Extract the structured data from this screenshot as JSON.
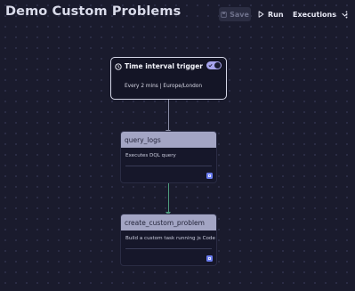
{
  "header": {
    "title": "Demo Custom Problems",
    "save_label": "Save",
    "run_label": "Run",
    "executions_label": "Executions",
    "more_icon": "more-vertical-icon"
  },
  "trigger": {
    "title": "Time interval trigger",
    "schedule": "Every 2 mins | Europe/London",
    "enabled": true,
    "icon": "clock-icon"
  },
  "tasks": [
    {
      "name": "query_logs",
      "description": "Executes DQL query"
    },
    {
      "name": "create_custom_problem",
      "description": "Build a custom task running js Code"
    }
  ],
  "colors": {
    "background": "#1a1b2d",
    "task_header": "#a3a5c4",
    "toggle_on": "#a8a5ee",
    "edge_success": "#4f9c7e",
    "badge": "#6a7cf0"
  }
}
